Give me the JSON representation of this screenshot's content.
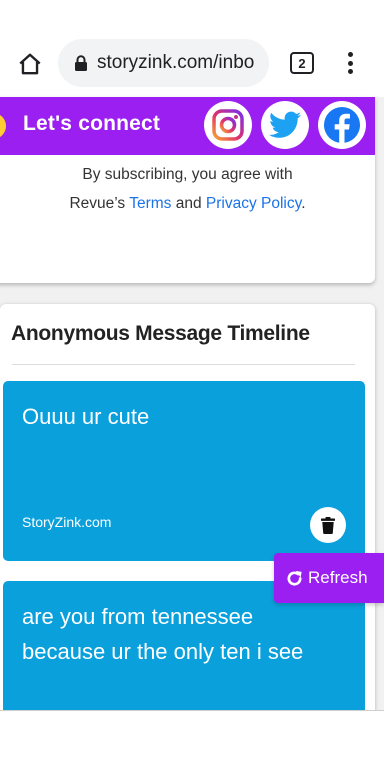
{
  "browser": {
    "url": "storyzink.com/inbo",
    "tab_count": "2"
  },
  "connect": {
    "label": "Let's connect"
  },
  "subscribe": {
    "line1": "By subscribing, you agree with",
    "prefix": "Revue’s ",
    "terms": "Terms",
    "and": " and ",
    "privacy": "Privacy Policy",
    "suffix": "."
  },
  "timeline": {
    "title": "Anonymous Message Timeline",
    "messages": [
      {
        "text": "Ouuu ur cute",
        "footer": "StoryZink.com"
      },
      {
        "text": "are you from tennessee because ur the only ten i see",
        "footer": ""
      }
    ]
  },
  "refresh": {
    "label": "Refresh"
  },
  "colors": {
    "brand_purple": "#9b1ff0",
    "message_blue": "#0aa0dc",
    "link_blue": "#1a73e8"
  }
}
